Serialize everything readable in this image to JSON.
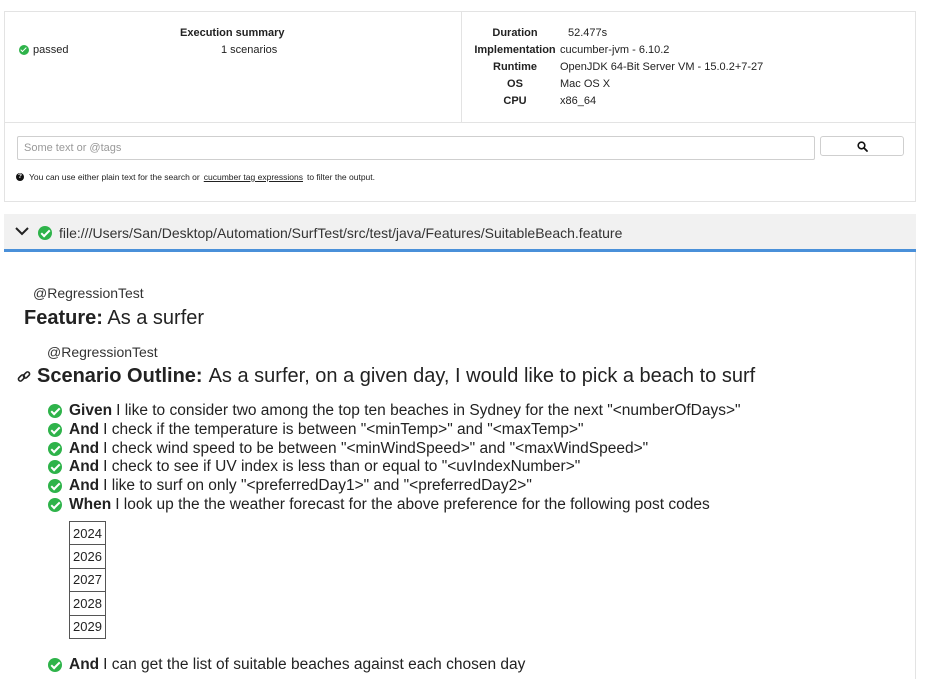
{
  "summary": {
    "title": "Execution summary",
    "status": "passed",
    "scenarios": "1 scenarios"
  },
  "environment": {
    "duration_label": "Duration",
    "duration_value": "52.477s",
    "implementation_label": "Implementation",
    "implementation_value": "cucumber-jvm - 6.10.2",
    "runtime_label": "Runtime",
    "runtime_value": "OpenJDK 64-Bit Server VM - 15.0.2+7-27",
    "os_label": "OS",
    "os_value": "Mac OS X",
    "cpu_label": "CPU",
    "cpu_value": "x86_64"
  },
  "search": {
    "placeholder": "Some text or @tags",
    "help_prefix": "You can use either plain text for the search or",
    "help_link": "cucumber tag expressions",
    "help_suffix": "to filter the output."
  },
  "file": {
    "path": "file:///Users/San/Desktop/Automation/SurfTest/src/test/java/Features/SuitableBeach.feature"
  },
  "feature": {
    "tag": "@RegressionTest",
    "keyword": "Feature:",
    "name": "As a surfer"
  },
  "scenario": {
    "tag": "@RegressionTest",
    "keyword": "Scenario Outline:",
    "name": "As a surfer, on a given day, I would like to pick a beach to surf"
  },
  "steps": [
    {
      "keyword": "Given",
      "text": "I like to consider two among the top ten beaches in Sydney for the next \"<numberOfDays>\""
    },
    {
      "keyword": "And",
      "text": "I check if the temperature is between \"<minTemp>\" and \"<maxTemp>\""
    },
    {
      "keyword": "And",
      "text": "I check wind speed to be between \"<minWindSpeed>\" and \"<maxWindSpeed>\""
    },
    {
      "keyword": "And",
      "text": "I check to see if UV index is less than or equal to \"<uvIndexNumber>\""
    },
    {
      "keyword": "And",
      "text": "I like to surf on only \"<preferredDay1>\" and \"<preferredDay2>\""
    },
    {
      "keyword": "When",
      "text": "I look up the the weather forecast for the above preference for the following post codes"
    },
    {
      "keyword": "And",
      "text": "I can get the list of suitable beaches against each chosen day"
    }
  ],
  "datatable": [
    "2024",
    "2026",
    "2027",
    "2028",
    "2029"
  ],
  "colors": {
    "passed": "#2eb34a",
    "accent": "#4a90d9"
  }
}
